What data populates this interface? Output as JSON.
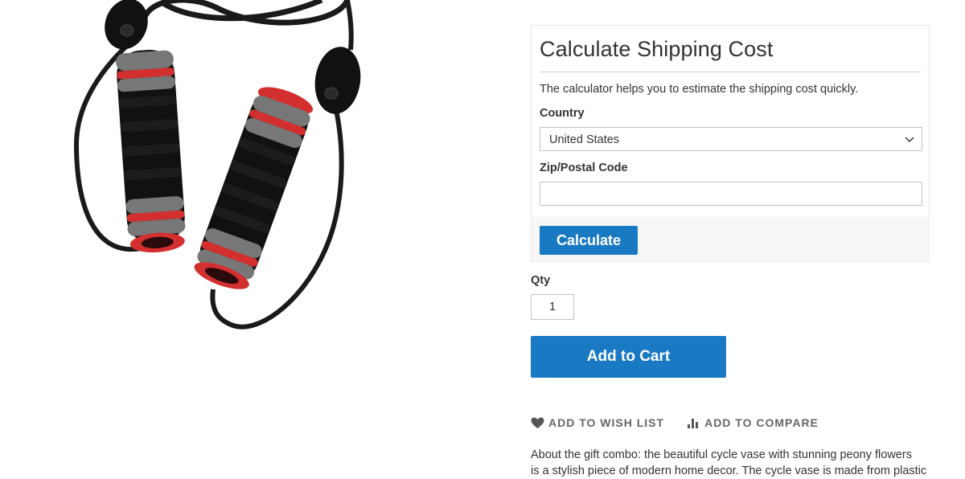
{
  "shipping": {
    "title": "Calculate Shipping Cost",
    "description": "The calculator helps you to estimate the shipping cost quickly.",
    "country_label": "Country",
    "country_value": "United States",
    "zip_label": "Zip/Postal Code",
    "zip_value": "",
    "calculate_label": "Calculate"
  },
  "qty": {
    "label": "Qty",
    "value": "1"
  },
  "cart": {
    "add_label": "Add to Cart"
  },
  "actions": {
    "wishlist_label": "ADD TO WISH LIST",
    "wishlist_icon": "heart-icon",
    "compare_label": "ADD TO COMPARE",
    "compare_icon": "bar-chart-icon"
  },
  "description": {
    "line1": "About the gift combo: the beautiful cycle vase with stunning peony flowers",
    "line2": "is a stylish piece of modern home decor. The cycle vase is made from plastic"
  },
  "colors": {
    "primary": "#1979c3",
    "text": "#333333",
    "muted": "#666666"
  }
}
